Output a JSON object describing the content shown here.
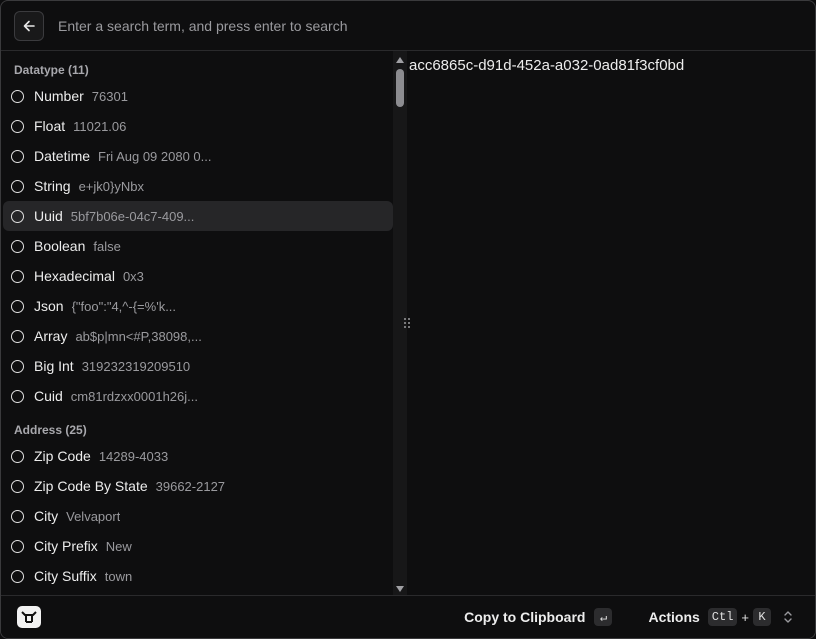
{
  "search": {
    "placeholder": "Enter a search term, and press enter to search"
  },
  "sections": [
    {
      "title": "Datatype (11)",
      "items": [
        {
          "label": "Number",
          "value": "76301"
        },
        {
          "label": "Float",
          "value": "11021.06"
        },
        {
          "label": "Datetime",
          "value": "Fri Aug 09 2080 0..."
        },
        {
          "label": "String",
          "value": "e+jk0}yNbx"
        },
        {
          "label": "Uuid",
          "value": "5bf7b06e-04c7-409...",
          "selected": true
        },
        {
          "label": "Boolean",
          "value": "false"
        },
        {
          "label": "Hexadecimal",
          "value": "0x3"
        },
        {
          "label": "Json",
          "value": "{\"foo\":\"4,^-{=%'k..."
        },
        {
          "label": "Array",
          "value": "ab$p|mn<#P,38098,..."
        },
        {
          "label": "Big Int",
          "value": "319232319209510"
        },
        {
          "label": "Cuid",
          "value": "cm81rdzxx0001h26j..."
        }
      ]
    },
    {
      "title": "Address (25)",
      "items": [
        {
          "label": "Zip Code",
          "value": "14289-4033"
        },
        {
          "label": "Zip Code By State",
          "value": "39662-2127"
        },
        {
          "label": "City",
          "value": "Velvaport"
        },
        {
          "label": "City Prefix",
          "value": "New"
        },
        {
          "label": "City Suffix",
          "value": "town"
        }
      ]
    }
  ],
  "detail": {
    "text": "acc6865c-d91d-452a-a032-0ad81f3cf0bd"
  },
  "footer": {
    "copy_label": "Copy to Clipboard",
    "copy_key": "↵",
    "actions_label": "Actions",
    "actions_key_1": "Ctl",
    "actions_plus": "+",
    "actions_key_2": "K"
  },
  "icons": {
    "back": "arrow-left-icon",
    "radio": "radio-circle-icon",
    "logo": "app-logo-icon",
    "chevrons": "chevron-up-down-icon"
  },
  "colors": {
    "background": "#0e0e0f",
    "selected_row": "#262628",
    "muted_text": "#9a9a9e"
  }
}
